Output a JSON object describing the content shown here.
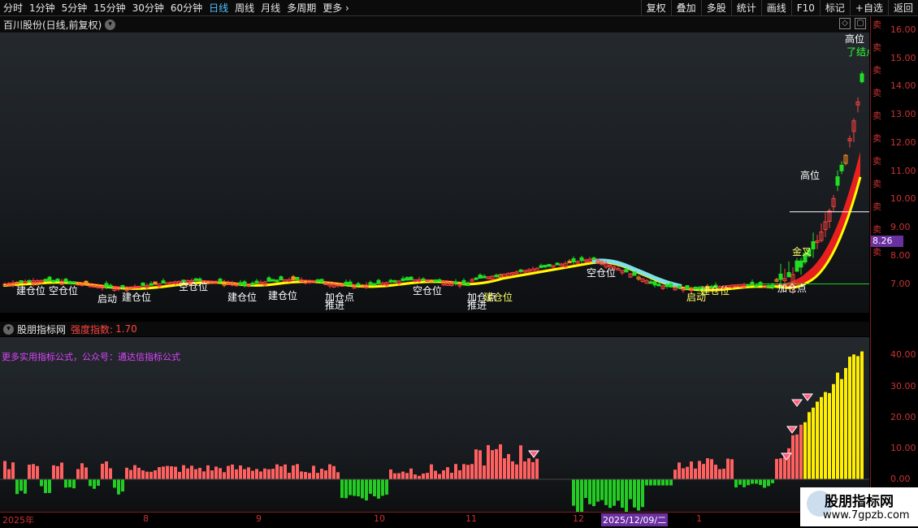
{
  "toolbar": {
    "periods": [
      "分时",
      "1分钟",
      "5分钟",
      "15分钟",
      "30分钟",
      "60分钟",
      "日线",
      "周线",
      "月线",
      "多周期",
      "更多"
    ],
    "active_period": "日线",
    "more_arrow": "›",
    "right_tools": [
      "复权",
      "叠加",
      "多股",
      "统计",
      "画线",
      "F10",
      "标记",
      "+自选",
      "返回"
    ]
  },
  "chart_title": "百川股份(日线,前复权)",
  "price_axis": {
    "ticks": [
      "16.00",
      "15.00",
      "14.00",
      "13.00",
      "12.00",
      "11.00",
      "10.00",
      "9.00",
      "8.00",
      "7.00"
    ],
    "current_price": "8.26"
  },
  "main_labels": [
    {
      "text": "建仓位",
      "color": "#ffffff"
    },
    {
      "text": "空仓位",
      "color": "#ffffff"
    },
    {
      "text": "启动",
      "color": "#ffffff"
    },
    {
      "text": "建仓位",
      "color": "#ffffff"
    },
    {
      "text": "空仓位",
      "color": "#ffffff"
    },
    {
      "text": "建仓位",
      "color": "#ffffff"
    },
    {
      "text": "建仓位",
      "color": "#ffffff"
    },
    {
      "text": "加仓点",
      "color": "#ffffff"
    },
    {
      "text": "推进",
      "color": "#ffffff"
    },
    {
      "text": "空仓位",
      "color": "#ffffff"
    },
    {
      "text": "加仓点",
      "color": "#ffffff"
    },
    {
      "text": "推进",
      "color": "#ffffff"
    },
    {
      "text": "建仓位",
      "color": "#ffff66"
    },
    {
      "text": "空仓位",
      "color": "#ffffff"
    },
    {
      "text": "启动",
      "color": "#ffff66"
    },
    {
      "text": "建仓位",
      "color": "#ffff66"
    },
    {
      "text": "加仓点",
      "color": "#ffffff"
    },
    {
      "text": "金叉",
      "color": "#ffff66"
    },
    {
      "text": "高位",
      "color": "#ffffff"
    },
    {
      "text": "高位",
      "color": "#ffffff"
    },
    {
      "text": "了结点",
      "color": "#33ff33"
    }
  ],
  "indicator": {
    "name": "股朋指标网",
    "strength_label": "强度指数:",
    "strength_value": "1.70",
    "promo": "更多实用指标公式，公众号：通达信指标公式",
    "ticks": [
      "40.00",
      "30.00",
      "20.00",
      "10.00",
      "0.00"
    ]
  },
  "date_axis": {
    "labels": [
      "2025年",
      "8",
      "9",
      "10",
      "11",
      "12",
      "1"
    ],
    "selected_date": "2025/12/09/二"
  },
  "watermark": {
    "title": "股朋指标网",
    "url": "www.7gpzb.com"
  },
  "right_edge_text": [
    "卖",
    "卖",
    "卖",
    "卖",
    "卖",
    "卖",
    "卖",
    "卖",
    "卖",
    "卖",
    "卖"
  ],
  "chart_data": {
    "type": "candlestick",
    "price_range": [
      6.5,
      16.5
    ],
    "ma_fast_color": "#ffff00",
    "ma_band_color": "#ff2020",
    "ma_cool_color": "#80e0e8",
    "indicator_range": [
      -10,
      45
    ],
    "pos_color": "#ff6060",
    "neg_color": "#22cc22",
    "peak_color": "#ffee00"
  }
}
